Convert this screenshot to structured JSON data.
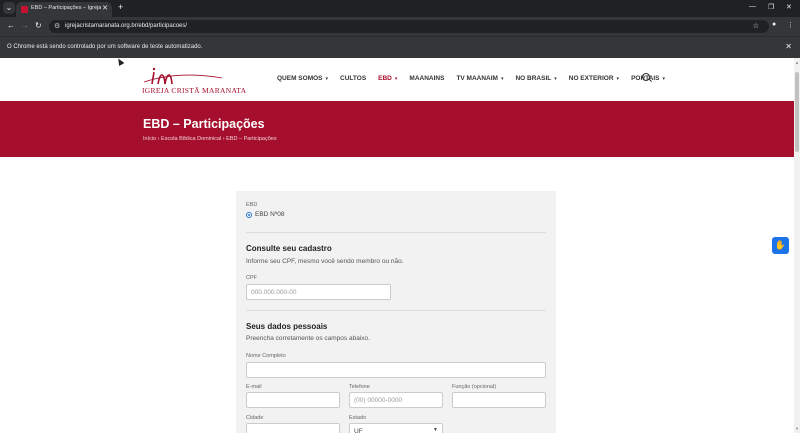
{
  "browser": {
    "tab_title": "EBD – Participações – Igreja Cri...",
    "url": "igrejacristamaranata.org.br/ebd/participacoes/",
    "infobar_text": "O Chrome está sendo controlado por um software de teste automatizado."
  },
  "site": {
    "logo_text": "IGREJA CRISTÃ MARANATA",
    "menu": [
      {
        "label": "QUEM SOMOS",
        "caret": "▾"
      },
      {
        "label": "CULTOS",
        "caret": ""
      },
      {
        "label": "EBD",
        "caret": "▾"
      },
      {
        "label": "MAANAINS",
        "caret": ""
      },
      {
        "label": "TV MAANAIM",
        "caret": "▾"
      },
      {
        "label": "NO BRASIL",
        "caret": "▾"
      },
      {
        "label": "NO EXTERIOR",
        "caret": "▾"
      },
      {
        "label": "PORTAIS",
        "caret": "▾"
      }
    ],
    "active_menu_color": "#a50f2d",
    "brand_color": "#a50f2d"
  },
  "banner": {
    "title": "EBD – Participações",
    "breadcrumb": "Início › Escola Bíblica Dominical › EBD – Participações"
  },
  "form": {
    "ebd_label": "EBD",
    "ebd_option": "EBD Nº08",
    "consult_heading": "Consulte seu cadastro",
    "consult_text": "Informe seu CPF, mesmo você sendo membro ou não.",
    "cpf_label": "CPF",
    "cpf_placeholder": "000.000.000-00",
    "personal_heading": "Seus dados pessoais",
    "personal_text": "Preencha corretamente os campos abaixo.",
    "name_label": "Nome Completo",
    "email_label": "E-mail",
    "phone_label": "Telefone",
    "phone_placeholder": "(00) 00000-0000",
    "role_label": "Função (opcional)",
    "city_label": "Cidade",
    "state_label": "Estado",
    "state_value": "UF"
  },
  "icons": {
    "tab_favicon": "church-favicon-icon",
    "search": "search-icon",
    "a11y": "accessibility-icon"
  }
}
